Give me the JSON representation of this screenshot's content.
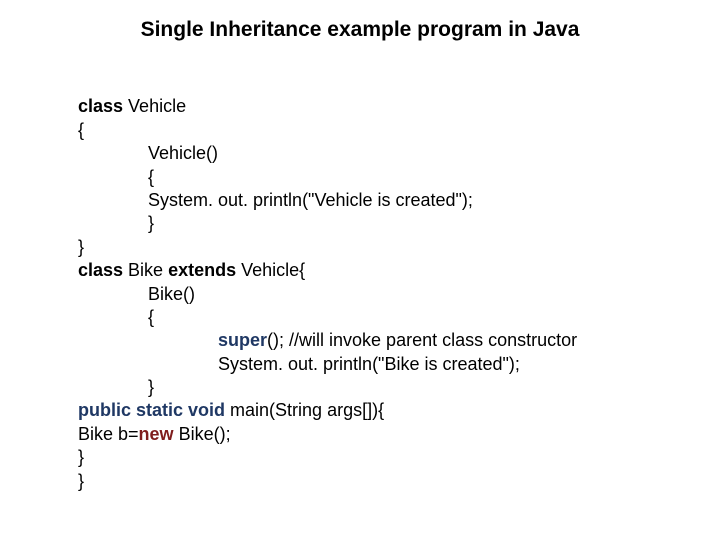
{
  "title": "Single Inheritance example program in Java",
  "code": {
    "l1a": "class",
    "l1b": " Vehicle",
    "l2": "{",
    "l3": "Vehicle()",
    "l4": "{",
    "l5": "System. out. println(\"Vehicle is created\");",
    "l6": "}",
    "l7": "}",
    "l8a": "class",
    "l8b": " Bike ",
    "l8c": "extends",
    "l8d": " Vehicle{",
    "l9": "Bike()",
    "l10": "{",
    "l11a": "super",
    "l11b": "(); //will invoke parent class constructor",
    "l12": "System. out. println(\"Bike is created\");",
    "l13": "}",
    "l14a": "public static void",
    "l14b": " main(String args[]){",
    "l15a": "Bike b=",
    "l15b": "new",
    "l15c": " Bike();",
    "l16": "}",
    "l17": "}"
  }
}
